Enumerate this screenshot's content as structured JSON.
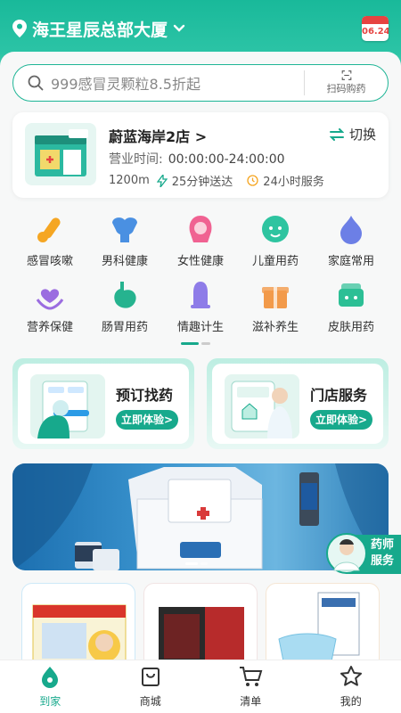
{
  "header": {
    "location": "海王星辰总部大厦",
    "calendar_date": "06.24"
  },
  "search": {
    "placeholder": "999感冒灵颗粒8.5折起",
    "scan_label": "扫码购药"
  },
  "store": {
    "name": "蔚蓝海岸2店",
    "hours_label": "营业时间:",
    "hours_value": "00:00:00-24:00:00",
    "distance": "1200m",
    "delivery": "25分钟送达",
    "service": "24小时服务",
    "switch_label": "切换"
  },
  "categories": [
    {
      "label": "感冒咳嗽",
      "icon": "thermometer-icon",
      "color": "#f5a623"
    },
    {
      "label": "男科健康",
      "icon": "muscle-icon",
      "color": "#4a90e2"
    },
    {
      "label": "女性健康",
      "icon": "woman-icon",
      "color": "#f06292"
    },
    {
      "label": "儿童用药",
      "icon": "baby-face-icon",
      "color": "#2ec4a0"
    },
    {
      "label": "家庭常用",
      "icon": "flame-icon",
      "color": "#6c7fe6"
    },
    {
      "label": "营养保健",
      "icon": "heart-hands-icon",
      "color": "#9b6de0"
    },
    {
      "label": "肠胃用药",
      "icon": "stomach-icon",
      "color": "#26b38f"
    },
    {
      "label": "情趣计生",
      "icon": "condom-icon",
      "color": "#8e7ce8"
    },
    {
      "label": "滋补养生",
      "icon": "gift-box-icon",
      "color": "#f29a4a"
    },
    {
      "label": "皮肤用药",
      "icon": "skin-cream-icon",
      "color": "#2cbf95"
    }
  ],
  "services": [
    {
      "title": "预订找药",
      "button": "立即体验>"
    },
    {
      "title": "门店服务",
      "button": "立即体验>"
    }
  ],
  "pharmacist": {
    "line1": "药师",
    "line2": "服务"
  },
  "tabs": [
    {
      "label": "到家",
      "icon": "home-drop-icon",
      "active": true
    },
    {
      "label": "商城",
      "icon": "shopping-bag-icon",
      "active": false
    },
    {
      "label": "清单",
      "icon": "cart-icon",
      "active": false
    },
    {
      "label": "我的",
      "icon": "star-icon",
      "active": false
    }
  ],
  "colors": {
    "brand": "#17a98c",
    "header_green": "#19b99a"
  }
}
